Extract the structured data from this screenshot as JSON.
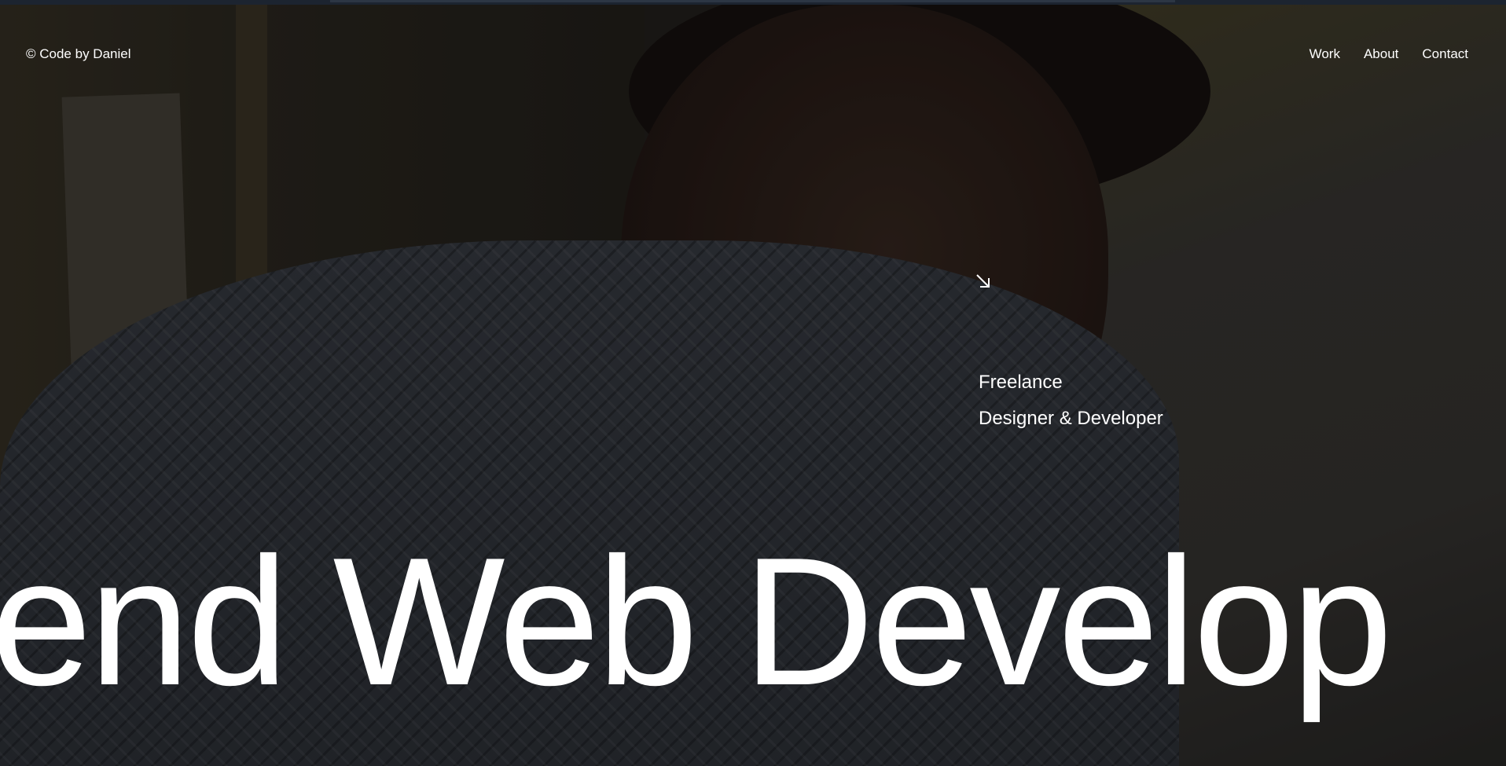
{
  "header": {
    "brand": "© Code by Daniel",
    "nav": [
      {
        "label": "Work"
      },
      {
        "label": "About"
      },
      {
        "label": "Contact"
      }
    ]
  },
  "hero": {
    "arrow_icon": "arrow-down-right-icon",
    "tagline_line1": "Freelance",
    "tagline_line2": "Designer & Developer",
    "marquee_text": "end Web Develop"
  },
  "colors": {
    "text": "#ffffff",
    "overlay": "#000000"
  }
}
